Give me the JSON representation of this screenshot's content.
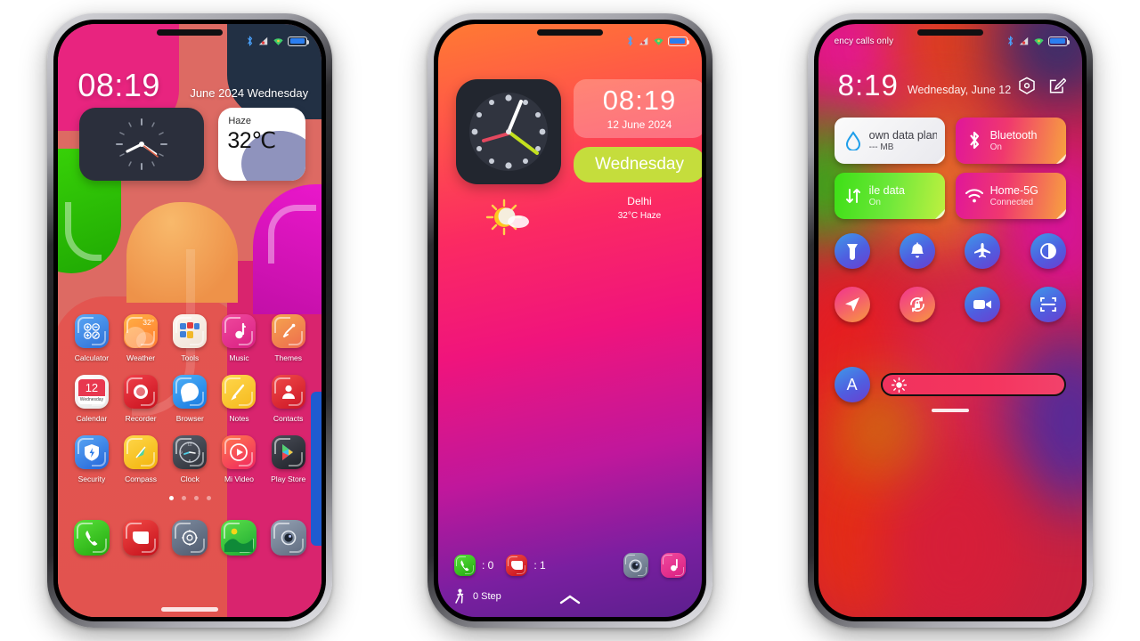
{
  "phone1": {
    "status": {
      "left": "",
      "icons": [
        "bluetooth-icon",
        "signal-icon",
        "wifi-icon",
        "battery-icon"
      ]
    },
    "time": "08:19",
    "date": "June 2024 Wednesday",
    "weather": {
      "condition": "Haze",
      "temp": "32℃"
    },
    "apps_row1": [
      {
        "label": "Calculator",
        "icon": "calculator-icon"
      },
      {
        "label": "Weather",
        "icon": "weather-icon",
        "badge": "32°"
      },
      {
        "label": "Tools",
        "icon": "tools-icon"
      },
      {
        "label": "Music",
        "icon": "music-icon"
      },
      {
        "label": "Themes",
        "icon": "themes-icon"
      }
    ],
    "apps_row2": [
      {
        "label": "Calendar",
        "icon": "calendar-icon",
        "day": "12",
        "weekday": "Wednesday"
      },
      {
        "label": "Recorder",
        "icon": "recorder-icon"
      },
      {
        "label": "Browser",
        "icon": "browser-icon"
      },
      {
        "label": "Notes",
        "icon": "notes-icon"
      },
      {
        "label": "Contacts",
        "icon": "contacts-icon"
      }
    ],
    "apps_row3": [
      {
        "label": "Security",
        "icon": "security-icon"
      },
      {
        "label": "Compass",
        "icon": "compass-icon"
      },
      {
        "label": "Clock",
        "icon": "clock-icon"
      },
      {
        "label": "Mi Video",
        "icon": "mi-video-icon"
      },
      {
        "label": "Play Store",
        "icon": "play-store-icon"
      }
    ],
    "page_dots": {
      "count": 4,
      "active": 0
    },
    "dock": [
      {
        "label": "Phone",
        "icon": "phone-icon"
      },
      {
        "label": "Messages",
        "icon": "messages-icon"
      },
      {
        "label": "Settings",
        "icon": "settings-icon"
      },
      {
        "label": "Gallery",
        "icon": "gallery-icon"
      },
      {
        "label": "Camera",
        "icon": "camera-icon"
      }
    ]
  },
  "phone2": {
    "time": "08:19",
    "date": "12 June 2024",
    "weekday": "Wednesday",
    "city": "Delhi",
    "condition": "32°C Haze",
    "missed_calls": ": 0",
    "unread_messages": ": 1",
    "steps": "0 Step",
    "shortcuts": [
      {
        "icon": "camera-icon",
        "name": "camera-shortcut"
      },
      {
        "icon": "music-icon",
        "name": "music-shortcut"
      }
    ]
  },
  "phone3": {
    "carrier": "ency calls only",
    "time": "8:19",
    "date": "Wednesday, June 12",
    "header_icons": [
      {
        "name": "settings-gear-icon"
      },
      {
        "name": "edit-icon"
      }
    ],
    "tiles": [
      {
        "title": "own data plan",
        "sub": "--- MB",
        "icon": "data-drop-icon",
        "style": "light"
      },
      {
        "title": "Bluetooth",
        "sub": "On",
        "icon": "bluetooth-icon",
        "style": "bt"
      },
      {
        "title": "ile data",
        "sub": "On",
        "icon": "mobile-data-icon",
        "style": "data"
      },
      {
        "title": "Home-5G",
        "sub": "Connected",
        "icon": "wifi-icon",
        "style": "wifi"
      }
    ],
    "toggles_row1": [
      {
        "name": "flashlight-toggle",
        "icon": "flashlight-icon",
        "style": "blue"
      },
      {
        "name": "silent-toggle",
        "icon": "bell-icon",
        "style": "blue"
      },
      {
        "name": "airplane-mode-toggle",
        "icon": "airplane-icon",
        "style": "blue"
      },
      {
        "name": "dark-mode-toggle",
        "icon": "contrast-icon",
        "style": "blue"
      }
    ],
    "toggles_row2": [
      {
        "name": "location-toggle",
        "icon": "location-arrow-icon",
        "style": "pinkgrad"
      },
      {
        "name": "rotation-lock-toggle",
        "icon": "rotation-lock-icon",
        "style": "pinkgrad"
      },
      {
        "name": "screen-recorder-toggle",
        "icon": "video-camera-icon",
        "style": "blue"
      },
      {
        "name": "scanner-toggle",
        "icon": "scan-icon",
        "style": "blue"
      }
    ],
    "auto_brightness_label": "A",
    "brightness": {
      "icon": "brightness-icon",
      "value": 100
    }
  },
  "colors": {
    "accent_pink": "#e8247f",
    "accent_green": "#39d408",
    "accent_magenta": "#ec18cd",
    "lime": "#c5dd3c",
    "blue": "#2b7ef0"
  }
}
